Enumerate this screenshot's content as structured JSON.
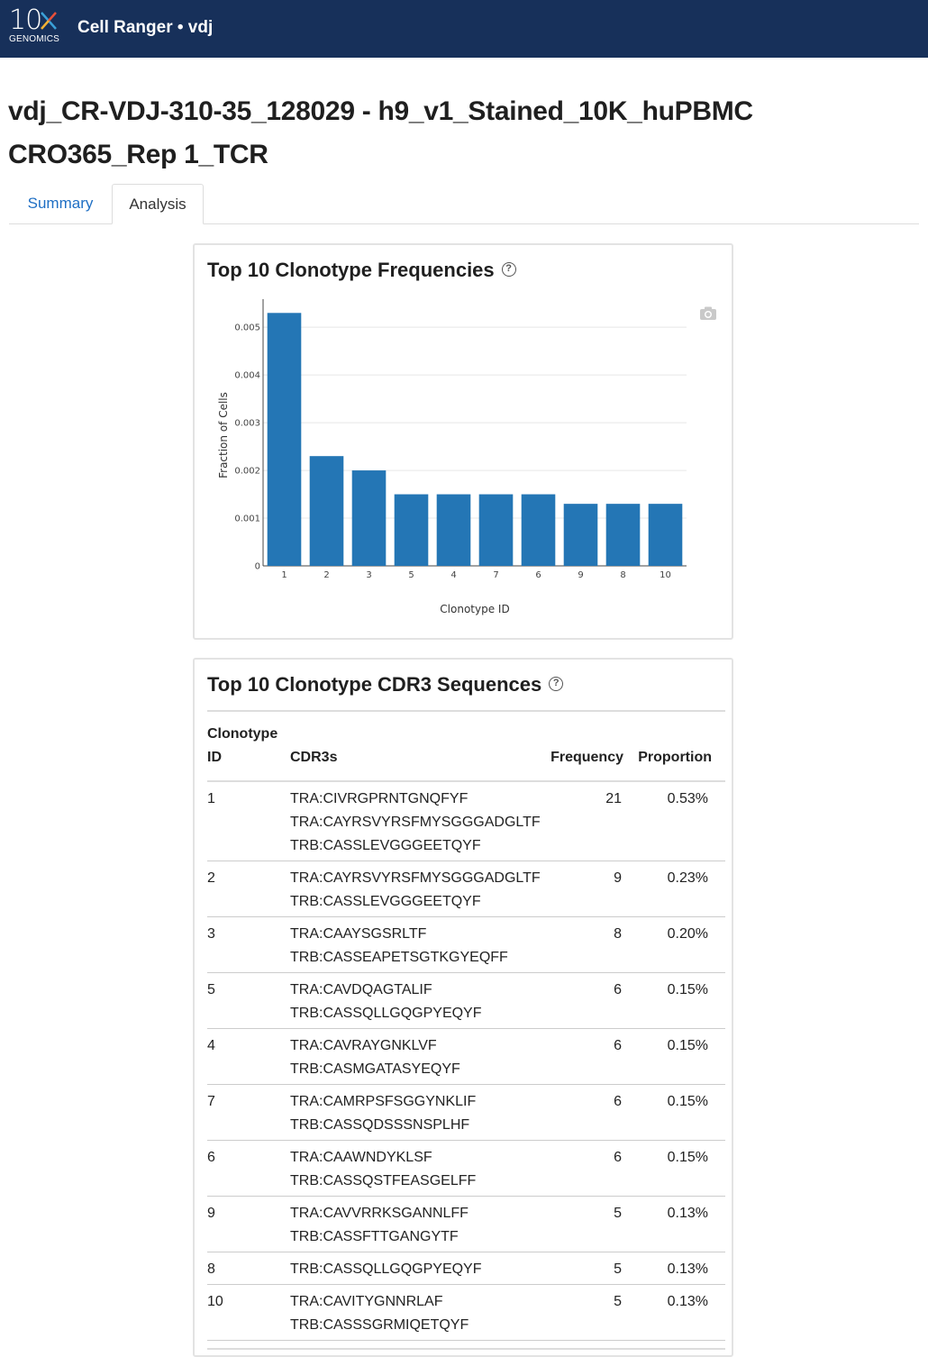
{
  "header": {
    "logo_main": "10",
    "logo_sub": "GENOMICS",
    "app_title": "Cell Ranger • vdj"
  },
  "page": {
    "title_line1": "vdj_CR-VDJ-310-35_128029 - h9_v1_Stained_10K_huPBMC",
    "title_line2": "CRO365_Rep 1_TCR"
  },
  "tabs": [
    {
      "label": "Summary",
      "active": false
    },
    {
      "label": "Analysis",
      "active": true
    }
  ],
  "chart_card": {
    "title": "Top 10 Clonotype Frequencies",
    "help_icon": "question-circle-icon",
    "toolbar_icon": "camera-icon"
  },
  "chart_data": {
    "type": "bar",
    "title": "Top 10 Clonotype Frequencies",
    "xlabel": "Clonotype ID",
    "ylabel": "Fraction of Cells",
    "categories": [
      "1",
      "2",
      "3",
      "5",
      "4",
      "7",
      "6",
      "9",
      "8",
      "10"
    ],
    "values": [
      0.0053,
      0.0023,
      0.002,
      0.0015,
      0.0015,
      0.0015,
      0.0015,
      0.0013,
      0.0013,
      0.0013
    ],
    "ylim": [
      0,
      0.0054
    ],
    "yticks": [
      "0",
      "0.001",
      "0.002",
      "0.003",
      "0.004",
      "0.005"
    ],
    "bar_color": "#2476b5",
    "grid": true
  },
  "table_card": {
    "title": "Top 10 Clonotype CDR3 Sequences",
    "help_icon": "question-circle-icon",
    "columns": {
      "id_line1": "Clonotype",
      "id_line2": "ID",
      "cdr3s": "CDR3s",
      "frequency": "Frequency",
      "proportion": "Proportion"
    },
    "rows": [
      {
        "id": "1",
        "cdr3s": [
          "TRA:CIVRGPRNTGNQFYF",
          "TRA:CAYRSVYRSFMYSGGGADGLTF",
          "TRB:CASSLEVGGGEETQYF"
        ],
        "frequency": "21",
        "proportion": "0.53%"
      },
      {
        "id": "2",
        "cdr3s": [
          "TRA:CAYRSVYRSFMYSGGGADGLTF",
          "TRB:CASSLEVGGGEETQYF"
        ],
        "frequency": "9",
        "proportion": "0.23%"
      },
      {
        "id": "3",
        "cdr3s": [
          "TRA:CAAYSGSRLTF",
          "TRB:CASSEAPETSGTKGYEQFF"
        ],
        "frequency": "8",
        "proportion": "0.20%"
      },
      {
        "id": "5",
        "cdr3s": [
          "TRA:CAVDQAGTALIF",
          "TRB:CASSQLLGQGPYEQYF"
        ],
        "frequency": "6",
        "proportion": "0.15%"
      },
      {
        "id": "4",
        "cdr3s": [
          "TRA:CAVRAYGNKLVF",
          "TRB:CASMGATASYEQYF"
        ],
        "frequency": "6",
        "proportion": "0.15%"
      },
      {
        "id": "7",
        "cdr3s": [
          "TRA:CAMRPSFSGGYNKLIF",
          "TRB:CASSQDSSSNSPLHF"
        ],
        "frequency": "6",
        "proportion": "0.15%"
      },
      {
        "id": "6",
        "cdr3s": [
          "TRA:CAAWNDYKLSF",
          "TRB:CASSQSTFEASGELFF"
        ],
        "frequency": "6",
        "proportion": "0.15%"
      },
      {
        "id": "9",
        "cdr3s": [
          "TRA:CAVVRRKSGANNLFF",
          "TRB:CASSFTTGANGYTF"
        ],
        "frequency": "5",
        "proportion": "0.13%"
      },
      {
        "id": "8",
        "cdr3s": [
          "TRB:CASSQLLGQGPYEQYF"
        ],
        "frequency": "5",
        "proportion": "0.13%"
      },
      {
        "id": "10",
        "cdr3s": [
          "TRA:CAVITYGNNRLAF",
          "TRB:CASSSGRMIQETQYF"
        ],
        "frequency": "5",
        "proportion": "0.13%"
      }
    ]
  }
}
